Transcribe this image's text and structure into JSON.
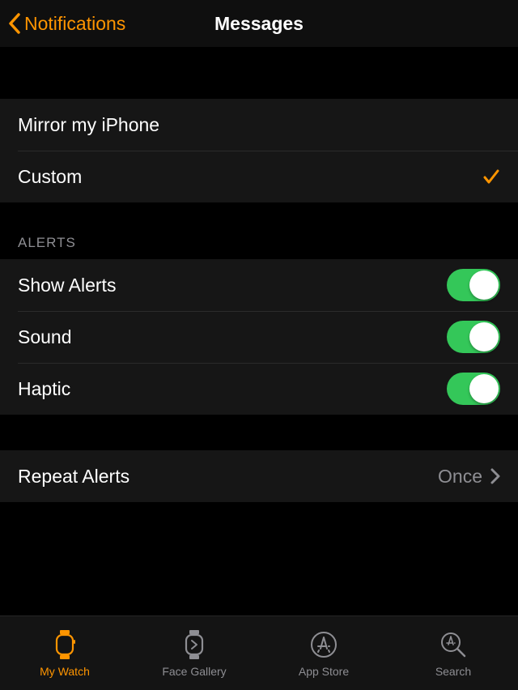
{
  "nav": {
    "back_label": "Notifications",
    "title": "Messages"
  },
  "mode": {
    "mirror_label": "Mirror my iPhone",
    "custom_label": "Custom"
  },
  "alerts": {
    "header": "ALERTS",
    "show_alerts_label": "Show Alerts",
    "sound_label": "Sound",
    "haptic_label": "Haptic",
    "show_alerts_on": true,
    "sound_on": true,
    "haptic_on": true
  },
  "repeat": {
    "label": "Repeat Alerts",
    "value": "Once"
  },
  "tabs": {
    "my_watch": "My Watch",
    "face_gallery": "Face Gallery",
    "app_store": "App Store",
    "search": "Search"
  },
  "colors": {
    "accent": "#ff9500",
    "toggle_on": "#34c759"
  }
}
